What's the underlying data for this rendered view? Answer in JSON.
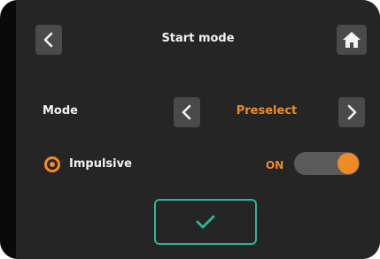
{
  "header": {
    "title": "Start mode",
    "back_icon": "chevron-left-icon",
    "home_icon": "home-icon"
  },
  "mode_row": {
    "label": "Mode",
    "value": "Preselect",
    "prev_icon": "chevron-left-icon",
    "next_icon": "chevron-right-icon"
  },
  "impulsive_row": {
    "label": "Impulsive",
    "radio_selected": true,
    "toggle_label": "ON",
    "toggle_on": true
  },
  "confirm": {
    "icon": "checkmark-icon"
  },
  "colors": {
    "accent": "#f08a24",
    "confirm": "#2bb59b",
    "background": "#252525",
    "button": "#4a4a4a"
  }
}
